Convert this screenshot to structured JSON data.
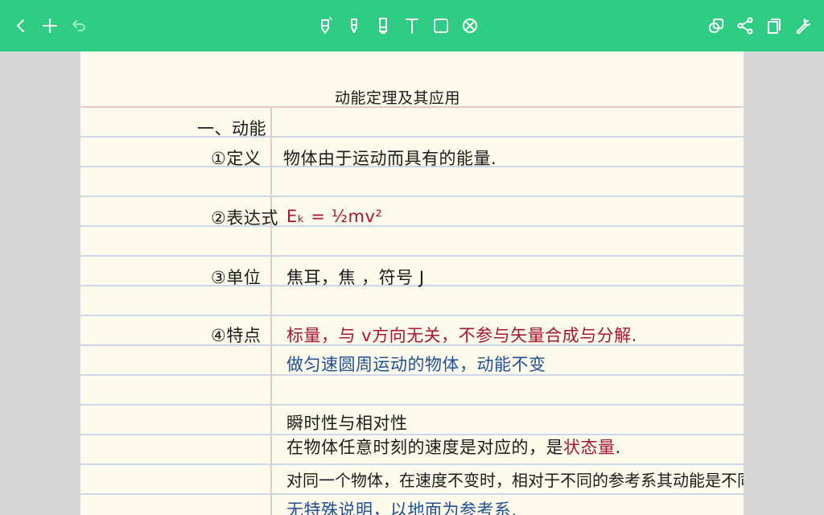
{
  "toolbar": {
    "left": [
      {
        "name": "back-button",
        "icon": "chevron-left-icon"
      },
      {
        "name": "add-page-button",
        "icon": "plus-icon"
      },
      {
        "name": "undo-button",
        "icon": "undo-icon"
      }
    ],
    "tools": [
      {
        "name": "pen-tool",
        "icon": "pen-icon"
      },
      {
        "name": "highlighter-tool",
        "icon": "highlighter-icon"
      },
      {
        "name": "eraser-tool",
        "icon": "eraser-icon"
      },
      {
        "name": "text-tool",
        "icon": "text-icon"
      },
      {
        "name": "lasso-tool",
        "icon": "lasso-icon"
      },
      {
        "name": "clear-tool",
        "icon": "clear-icon"
      }
    ],
    "right": [
      {
        "name": "layers-button",
        "icon": "layers-icon"
      },
      {
        "name": "share-button",
        "icon": "share-icon"
      },
      {
        "name": "copy-button",
        "icon": "copy-icon"
      },
      {
        "name": "settings-button",
        "icon": "wrench-icon"
      }
    ],
    "colors": {
      "background": "#2fcc84",
      "icon": "#ffffff"
    }
  },
  "note": {
    "title": "动能定理及其应用",
    "section": "一、动能",
    "rows": {
      "definition_label": "①定义",
      "definition_text": "物体由于运动而具有的能量.",
      "expression_label": "②表达式",
      "expression_text": "Eₖ = ½mv²",
      "unit_label": "③单位",
      "unit_text": "焦耳，焦 ，符号 J",
      "feature_label": "④特点",
      "feature_line1": "标量，与 v方向无关，不参与矢量合成与分解.",
      "feature_line2": "做匀速圆周运动的物体，动能不变",
      "instant_heading": "瞬时性与相对性",
      "instant_line_prefix": "在物体任意时刻的速度是对应的，是",
      "instant_line_highlight": "状态量",
      "instant_line_suffix": ".",
      "relative_line": "对同一个物体，在速度不变时，相对于不同的参考系其动能是不同",
      "cutoff_line": "无特殊说明，以地面为参考系."
    },
    "colors": {
      "paper": "#fdfbec",
      "ink": "#1b1b1b",
      "red_ink": "#a8162c",
      "blue_ink": "#1f4f96",
      "rule": "#c9d7e6",
      "margin": "#e8c7c0"
    }
  }
}
